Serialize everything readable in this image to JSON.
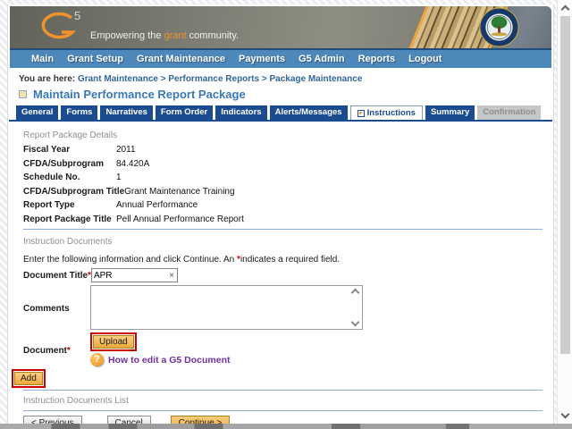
{
  "header": {
    "logo_number": "5",
    "tagline_prefix": "Empowering the ",
    "tagline_highlight": "grant",
    "tagline_suffix": " community."
  },
  "nav": {
    "items": [
      "Main",
      "Grant Setup",
      "Grant Maintenance",
      "Payments",
      "G5 Admin",
      "Reports",
      "Logout"
    ]
  },
  "breadcrumb": {
    "prefix": "You are here:",
    "path": "Grant Maintenance > Performance Reports > Package Maintenance"
  },
  "page_title": "Maintain Performance Report Package",
  "tabs": [
    {
      "label": "General",
      "state": "normal"
    },
    {
      "label": "Forms",
      "state": "normal"
    },
    {
      "label": "Narratives",
      "state": "normal"
    },
    {
      "label": "Form Order",
      "state": "normal"
    },
    {
      "label": "Indicators",
      "state": "normal"
    },
    {
      "label": "Alerts/Messages",
      "state": "normal"
    },
    {
      "label": "Instructions",
      "state": "active"
    },
    {
      "label": "Summary",
      "state": "normal"
    },
    {
      "label": "Confirmation",
      "state": "disabled"
    }
  ],
  "report_details": {
    "section_label": "Report Package Details",
    "fields": [
      {
        "label": "Fiscal Year",
        "value": "2011"
      },
      {
        "label": "CFDA/Subprogram",
        "value": "84.420A"
      },
      {
        "label": "Schedule No.",
        "value": "1"
      },
      {
        "label": "CFDA/Subprogram Title",
        "value": "Grant Maintenance Training"
      },
      {
        "label": "Report Type",
        "value": "Annual Performance"
      },
      {
        "label": "Report Package Title",
        "value": "Pell Annual Performance Report"
      }
    ]
  },
  "instruction_documents": {
    "section_label": "Instruction Documents",
    "intro_before": "Enter the following information and click Continue.  An ",
    "required_marker": "*",
    "intro_after": "indicates a required field.",
    "document_title_label": "Document Title",
    "document_title_value": "APR",
    "clear_icon": "×",
    "comments_label": "Comments",
    "upload_button_label": "Upload",
    "document_label": "Document",
    "help_icon": "?",
    "help_link_label": "How to edit a G5 Document",
    "add_button_label": "Add"
  },
  "documents_list": {
    "section_label": "Instruction Documents List"
  },
  "footer": {
    "previous_label": "< Previous",
    "cancel_label": "Cancel",
    "continue_label": "Continue >"
  },
  "colors": {
    "nav_blue": "#4e87ba",
    "tab_blue": "#1b4c8f",
    "accent_orange": "#f0932b",
    "annotation_red": "#cc0000",
    "link_purple": "#7030a0",
    "rule_blue": "#8cb0d8"
  }
}
